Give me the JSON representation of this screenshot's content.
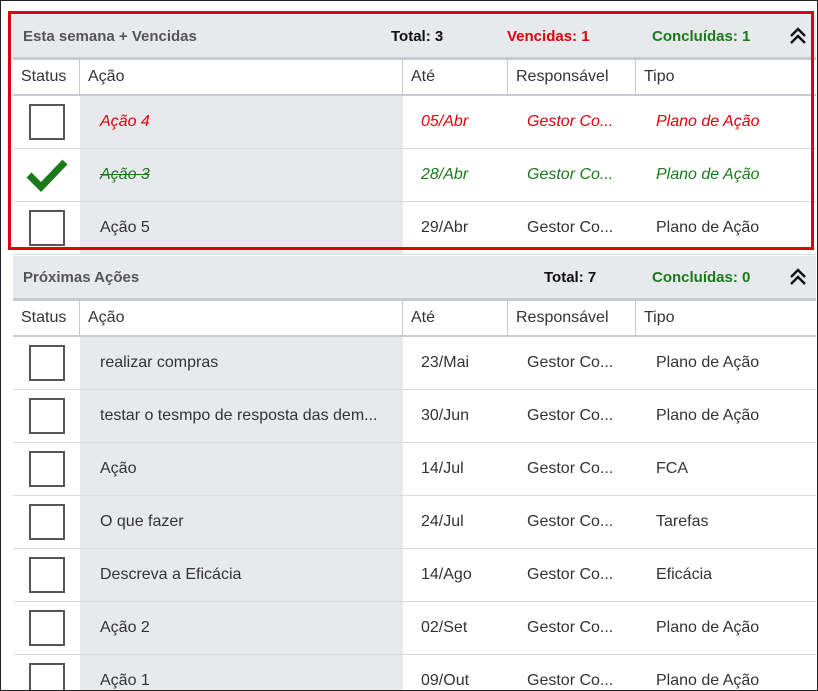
{
  "section_week": {
    "title": "Esta semana + Vencidas",
    "total": "Total: 3",
    "vencidas": "Vencidas: 1",
    "concluidas": "Concluídas: 1",
    "highlight_color": "#e0000b",
    "collapse_icon": "double-chevron-up-icon",
    "columns": {
      "status": "Status",
      "acao": "Ação",
      "ate": "Até",
      "responsavel": "Responsável",
      "tipo": "Tipo"
    },
    "rows": [
      {
        "state": "overdue",
        "acao": "Ação 4",
        "ate": "05/Abr",
        "responsavel": "Gestor Co...",
        "tipo": "Plano de Ação"
      },
      {
        "state": "done",
        "acao": "Ação 3",
        "ate": "28/Abr",
        "responsavel": "Gestor Co...",
        "tipo": "Plano de Ação"
      },
      {
        "state": "pending",
        "acao": "Ação 5",
        "ate": "29/Abr",
        "responsavel": "Gestor Co...",
        "tipo": "Plano de Ação"
      }
    ]
  },
  "section_next": {
    "title": "Próximas Ações",
    "total": "Total: 7",
    "concluidas": "Concluídas: 0",
    "collapse_icon": "double-chevron-up-icon",
    "columns": {
      "status": "Status",
      "acao": "Ação",
      "ate": "Até",
      "responsavel": "Responsável",
      "tipo": "Tipo"
    },
    "rows": [
      {
        "state": "pending",
        "acao": "realizar compras",
        "ate": "23/Mai",
        "responsavel": "Gestor Co...",
        "tipo": "Plano de Ação"
      },
      {
        "state": "pending",
        "acao": "testar o tesmpo de resposta das dem...",
        "ate": "30/Jun",
        "responsavel": "Gestor Co...",
        "tipo": "Plano de Ação"
      },
      {
        "state": "pending",
        "acao": "Ação",
        "ate": "14/Jul",
        "responsavel": "Gestor Co...",
        "tipo": "FCA"
      },
      {
        "state": "pending",
        "acao": "O que fazer",
        "ate": "24/Jul",
        "responsavel": "Gestor Co...",
        "tipo": "Tarefas"
      },
      {
        "state": "pending",
        "acao": "Descreva a Eficácia",
        "ate": "14/Ago",
        "responsavel": "Gestor Co...",
        "tipo": "Eficácia"
      },
      {
        "state": "pending",
        "acao": "Ação 2",
        "ate": "02/Set",
        "responsavel": "Gestor Co...",
        "tipo": "Plano de Ação"
      },
      {
        "state": "pending",
        "acao": "Ação 1",
        "ate": "09/Out",
        "responsavel": "Gestor Co...",
        "tipo": "Plano de Ação"
      }
    ]
  },
  "colors": {
    "overdue": "#e0000b",
    "done": "#1a7a1a",
    "header_bg": "#e7e9ec"
  }
}
